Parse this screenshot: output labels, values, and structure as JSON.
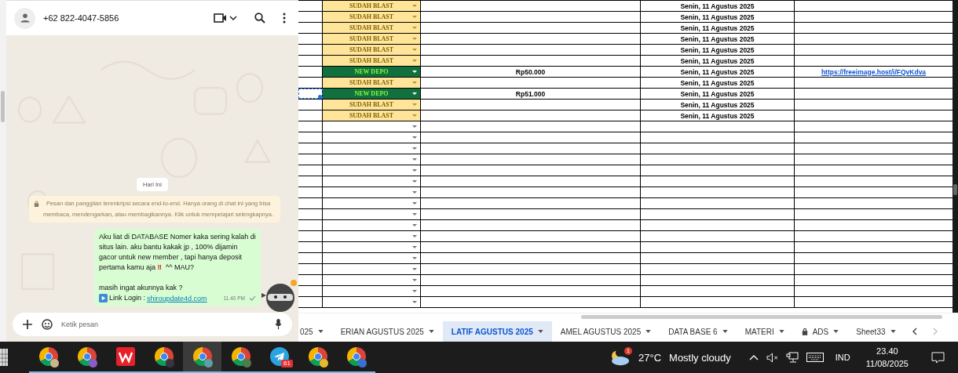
{
  "chat": {
    "contact": "+62 822-4047-5856",
    "date_chip": "Hari Ini",
    "notice": "Pesan dan panggilan terenkripsi secara end-to-end. Hanya orang di chat ini yang bisa membaca, mendengarkan, atau membagikannya. Klik untuk mempelajari selengkapnya.",
    "message": {
      "body_start": "Aku liat di DATABASE Nomer kaka sering kalah di situs lain. aku bantu kakak jp , 100% dijamin gacor untuk new member , tapi hanya deposit pertama kamu aja",
      "mark": "‼",
      "body_end": "^^ MAU?",
      "second_line": "masih ingat akunnya kak ?",
      "link_label": "Link Login :",
      "link": "shiroupdate4d.com",
      "time": "11.40 PM",
      "read": false
    },
    "composer": {
      "placeholder": "Ketik pesan"
    },
    "agent_badge": true
  },
  "sheet": {
    "rows": [
      {
        "kind": "blast",
        "status": "SUDAH BLAST",
        "date": "Senin, 11 Agustus 2025",
        "selected": false
      },
      {
        "kind": "blast",
        "status": "SUDAH BLAST",
        "date": "Senin, 11 Agustus 2025",
        "selected": false
      },
      {
        "kind": "blast",
        "status": "SUDAH BLAST",
        "date": "Senin, 11 Agustus 2025",
        "selected": false
      },
      {
        "kind": "blast",
        "status": "SUDAH BLAST",
        "date": "Senin, 11 Agustus 2025",
        "selected": false
      },
      {
        "kind": "blast",
        "status": "SUDAH BLAST",
        "date": "Senin, 11 Agustus 2025",
        "selected": false
      },
      {
        "kind": "blast",
        "status": "SUDAH BLAST",
        "date": "Senin, 11 Agustus 2025",
        "selected": false
      },
      {
        "kind": "depo",
        "status": "NEW DEPO",
        "amount": "Rp50.000",
        "date": "Senin, 11 Agustus 2025",
        "link": "https://freeimage.host/i/FQvKdva",
        "selected": false
      },
      {
        "kind": "blast",
        "status": "SUDAH BLAST",
        "date": "Senin, 11 Agustus 2025",
        "selected": false
      },
      {
        "kind": "depo",
        "status": "NEW DEPO",
        "amount": "Rp51.000",
        "date": "Senin, 11 Agustus 2025",
        "selected": true
      },
      {
        "kind": "blast",
        "status": "SUDAH BLAST",
        "date": "Senin, 11 Agustus 2025",
        "selected": false
      },
      {
        "kind": "blast",
        "status": "SUDAH BLAST",
        "date": "Senin, 11 Agustus 2025",
        "selected": false
      },
      {
        "kind": "empty",
        "selected": false
      },
      {
        "kind": "empty",
        "selected": false
      },
      {
        "kind": "empty",
        "selected": false
      },
      {
        "kind": "empty",
        "selected": false
      },
      {
        "kind": "empty",
        "selected": false
      },
      {
        "kind": "empty",
        "selected": false
      },
      {
        "kind": "empty",
        "selected": false
      },
      {
        "kind": "empty",
        "selected": false
      },
      {
        "kind": "empty",
        "selected": false
      },
      {
        "kind": "empty",
        "selected": false
      },
      {
        "kind": "empty",
        "selected": false
      },
      {
        "kind": "empty",
        "selected": false
      },
      {
        "kind": "empty",
        "selected": false
      },
      {
        "kind": "empty",
        "selected": false
      },
      {
        "kind": "empty",
        "selected": false
      },
      {
        "kind": "empty",
        "selected": false
      },
      {
        "kind": "empty",
        "selected": false
      }
    ],
    "tabs": [
      {
        "label": "025",
        "selected": false,
        "locked": false
      },
      {
        "label": "ERIAN AGUSTUS 2025",
        "selected": false,
        "locked": false
      },
      {
        "label": "LATIF AGUSTUS 2025",
        "selected": true,
        "locked": false
      },
      {
        "label": "AMEL AGUSTUS 2025",
        "selected": false,
        "locked": false
      },
      {
        "label": "DATA BASE 6",
        "selected": false,
        "locked": false
      },
      {
        "label": "MATERI",
        "selected": false,
        "locked": false
      },
      {
        "label": "ADS",
        "selected": false,
        "locked": true
      },
      {
        "label": "Sheet33",
        "selected": false,
        "locked": false
      }
    ]
  },
  "taskbar": {
    "apps": [
      {
        "kind": "chrome",
        "color": "#c9b98a",
        "active": false
      },
      {
        "kind": "chrome",
        "color": "#8a5cc9",
        "active": false
      },
      {
        "kind": "wps",
        "active": false
      },
      {
        "kind": "chrome",
        "color": "#3a3344",
        "active": false
      },
      {
        "kind": "chrome",
        "color": "#5f9ea8",
        "active": true
      },
      {
        "kind": "chrome",
        "color": "#4f7a4f",
        "active": false
      },
      {
        "kind": "telegram",
        "count": "61",
        "active": false
      },
      {
        "kind": "chrome",
        "color": "#e8b92e",
        "active": false
      },
      {
        "kind": "chrome",
        "color": "#3b6fd8",
        "active": false
      }
    ],
    "weather": {
      "alert": "1",
      "temp": "27°C",
      "condition": "Mostly cloudy"
    },
    "language": "IND",
    "time": "23.40",
    "date": "11/08/2025"
  }
}
